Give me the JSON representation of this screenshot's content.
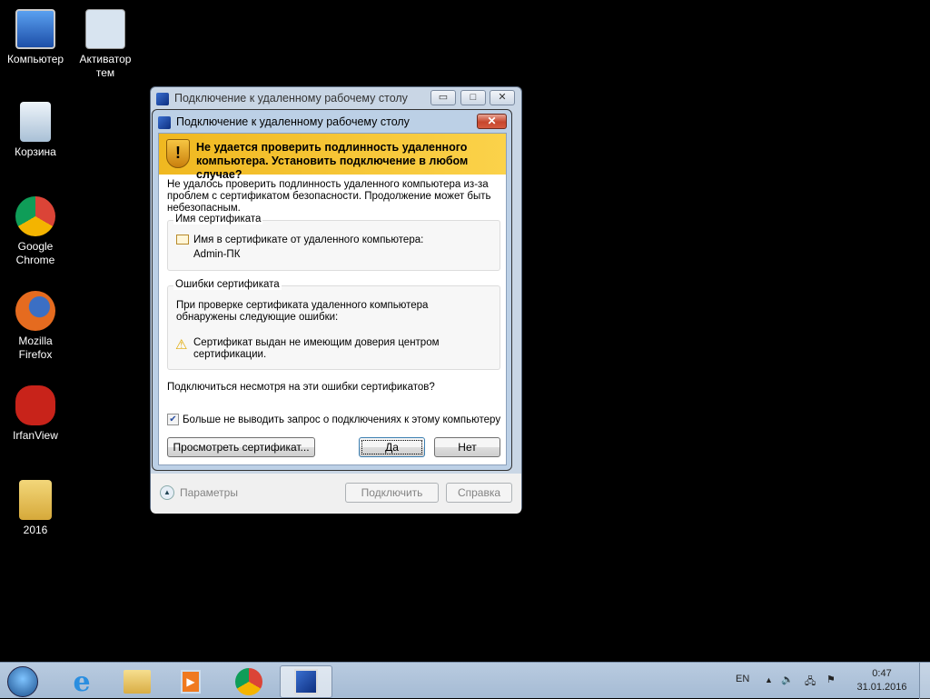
{
  "desktop": {
    "icons": [
      {
        "label": "Компьютер",
        "color": "#3a7bd5"
      },
      {
        "label": "Активатор тем",
        "color": "#d8e4f0"
      },
      {
        "label": "Корзина",
        "color": "#cfe0ee"
      },
      {
        "label": "Google Chrome",
        "color": "#2ea44f"
      },
      {
        "label": "Mozilla Firefox",
        "color": "#e56b1f"
      },
      {
        "label": "IrfanView",
        "color": "#d42a1a"
      },
      {
        "label": "2016",
        "color": "#e8c45a"
      }
    ]
  },
  "outer_window": {
    "title": "Подключение к удаленному рабочему столу",
    "minimize": "▭",
    "maximize": "□",
    "close": "✕",
    "options_label": "Параметры",
    "connect_label": "Подключить",
    "help_label": "Справка"
  },
  "dialog": {
    "title": "Подключение к удаленному рабочему столу",
    "close": "✕",
    "banner": "Не удается проверить подлинность удаленного компьютера. Установить подключение в любом случае?",
    "description": "Не удалось проверить подлинность удаленного компьютера из-за проблем с сертификатом безопасности. Продолжение может быть небезопасным.",
    "cert_name_group": {
      "label": "Имя сертификата",
      "text": "Имя в сертификате от удаленного компьютера:",
      "value": "Admin-ПК"
    },
    "cert_errors_group": {
      "label": "Ошибки сертификата",
      "text": "При проверке сертификата удаленного компьютера обнаружены следующие ошибки:",
      "error": "Сертификат выдан не имеющим доверия центром сертификации."
    },
    "question": "Подключиться несмотря на эти ошибки сертификатов?",
    "checkbox": {
      "label": "Больше не выводить запрос о подключениях к этому компьютеру",
      "checked": true
    },
    "view_cert_label": "Просмотреть сертификат...",
    "yes_label": "Да",
    "no_label": "Нет"
  },
  "taskbar": {
    "items": [
      "start",
      "internet-explorer",
      "explorer",
      "media-player",
      "chrome",
      "remote-desktop"
    ],
    "active": "remote-desktop",
    "lang": "EN",
    "time": "0:47",
    "date": "31.01.2016"
  }
}
